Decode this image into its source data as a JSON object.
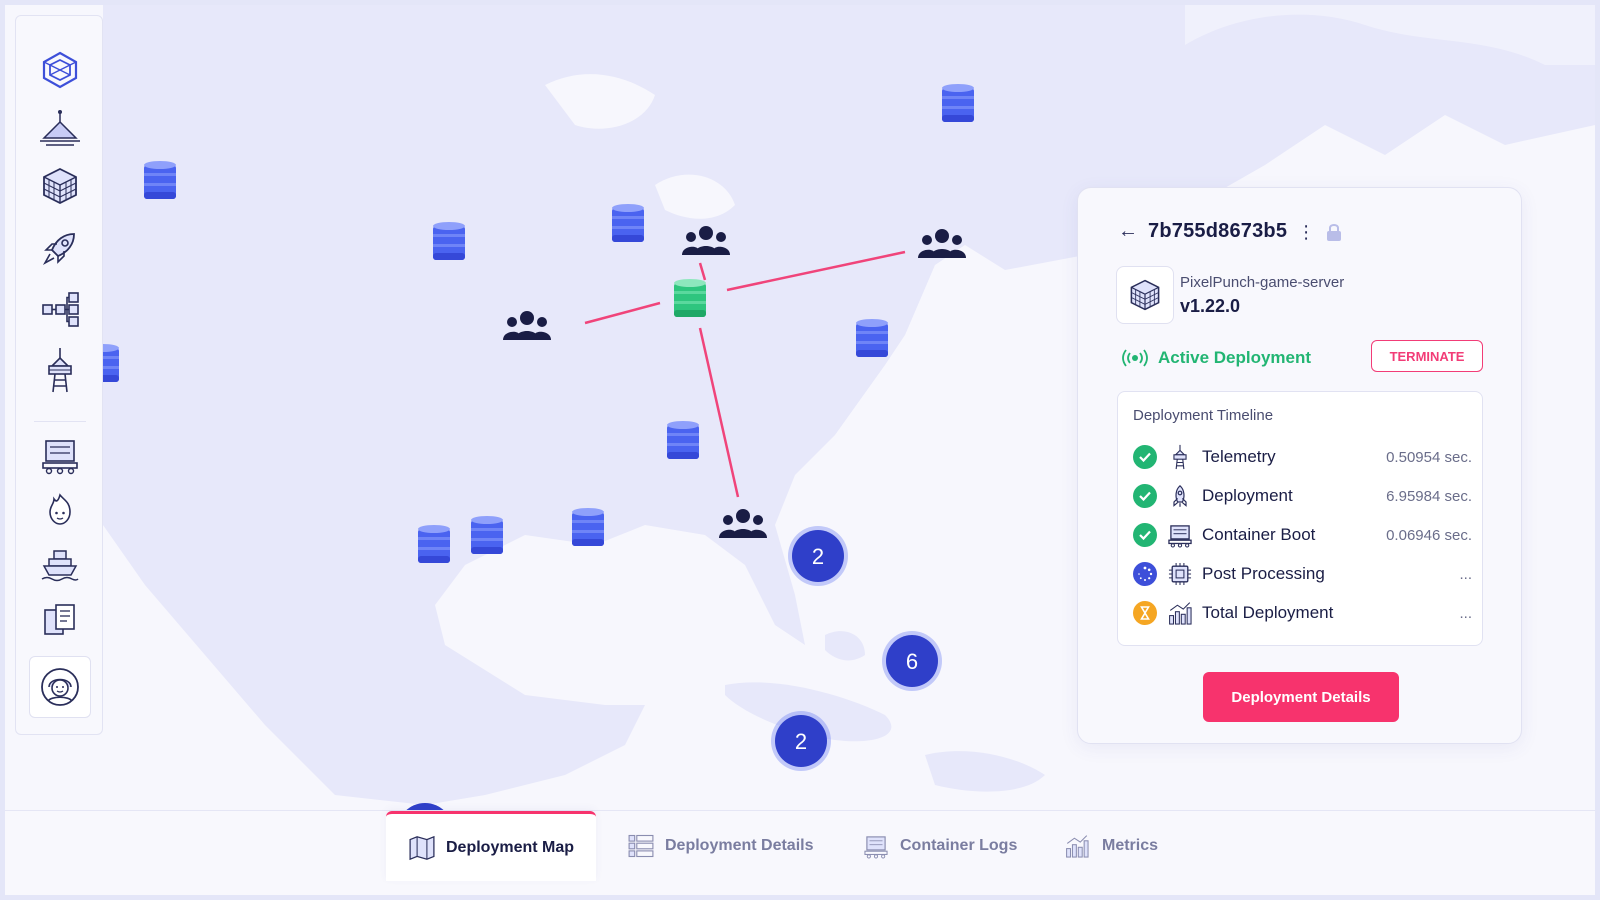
{
  "sidebar": {
    "items": [
      {
        "icon": "cube-logo-icon"
      },
      {
        "icon": "beacon-icon"
      },
      {
        "icon": "rubiks-cube-icon"
      },
      {
        "icon": "rocket-icon"
      },
      {
        "icon": "network-tree-icon"
      },
      {
        "icon": "tower-icon"
      },
      {
        "icon": "container-icon"
      },
      {
        "icon": "fire-face-icon"
      },
      {
        "icon": "ship-icon"
      },
      {
        "icon": "documents-icon"
      }
    ],
    "avatar": "user-avatar-icon"
  },
  "map": {
    "clusters": [
      {
        "count": "2"
      },
      {
        "count": "6"
      },
      {
        "count": "2"
      }
    ]
  },
  "panel": {
    "deployment_id": "7b755d8673b5",
    "service_name": "PixelPunch-game-server",
    "version": "v1.22.0",
    "status": "Active Deployment",
    "terminate_label": "TERMINATE",
    "timeline_title": "Deployment Timeline",
    "timeline": [
      {
        "label": "Telemetry",
        "time": "0.50954 sec.",
        "state": "done",
        "icon": "tower-icon"
      },
      {
        "label": "Deployment",
        "time": "6.95984 sec.",
        "state": "done",
        "icon": "rocket-icon"
      },
      {
        "label": "Container Boot",
        "time": "0.06946 sec.",
        "state": "done",
        "icon": "container-icon"
      },
      {
        "label": "Post Processing",
        "time": "...",
        "state": "running",
        "icon": "chip-icon"
      },
      {
        "label": "Total Deployment",
        "time": "...",
        "state": "pending",
        "icon": "bar-chart-icon"
      }
    ],
    "details_button": "Deployment Details"
  },
  "tabs": [
    {
      "label": "Deployment Map",
      "active": true
    },
    {
      "label": "Deployment Details",
      "active": false
    },
    {
      "label": "Container Logs",
      "active": false
    },
    {
      "label": "Metrics",
      "active": false
    }
  ],
  "colors": {
    "accent": "#f7336d",
    "success": "#22b573",
    "primary": "#3d4fd9",
    "ink": "#1a1d45",
    "pending": "#f5a623"
  }
}
